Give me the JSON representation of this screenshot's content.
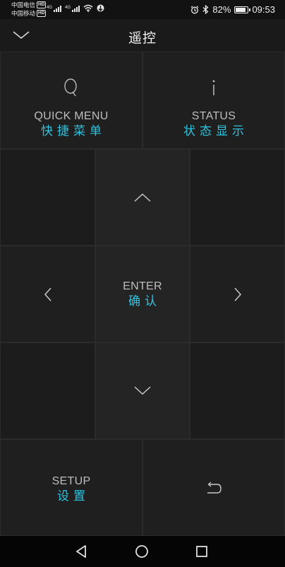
{
  "status_bar": {
    "carrier_1": "中国电信",
    "carrier_1_badge": "HD",
    "carrier_2": "中国移动",
    "carrier_2_badge": "HD",
    "network_1": "4G",
    "network_2": "4G",
    "battery_percent": "82%",
    "battery_level": 0.82,
    "time": "09:53",
    "icons": [
      "wifi-icon",
      "hotspot-icon",
      "alarm-icon",
      "bluetooth-icon",
      "battery-icon"
    ]
  },
  "header": {
    "title": "遥控",
    "collapse_icon": "chevron-down-icon"
  },
  "remote": {
    "quick_menu": {
      "icon": "magnifier-icon",
      "label_en": "QUICK MENU",
      "label_cn": "快捷菜单"
    },
    "status": {
      "icon": "info-icon",
      "label_en": "STATUS",
      "label_cn": "状态显示"
    },
    "up": {
      "icon": "chevron-up-icon"
    },
    "left": {
      "icon": "chevron-left-icon"
    },
    "enter": {
      "label_en": "ENTER",
      "label_cn": "确认"
    },
    "right": {
      "icon": "chevron-right-icon"
    },
    "down": {
      "icon": "chevron-down-icon"
    },
    "setup": {
      "label_en": "SETUP",
      "label_cn": "设置"
    },
    "back": {
      "icon": "return-icon"
    }
  },
  "navigation_bar": {
    "items": [
      "back-triangle-icon",
      "home-circle-icon",
      "recents-square-icon"
    ]
  },
  "colors": {
    "accent": "#2ec4e0",
    "tile": "#1f1f1f",
    "background": "#141414"
  }
}
